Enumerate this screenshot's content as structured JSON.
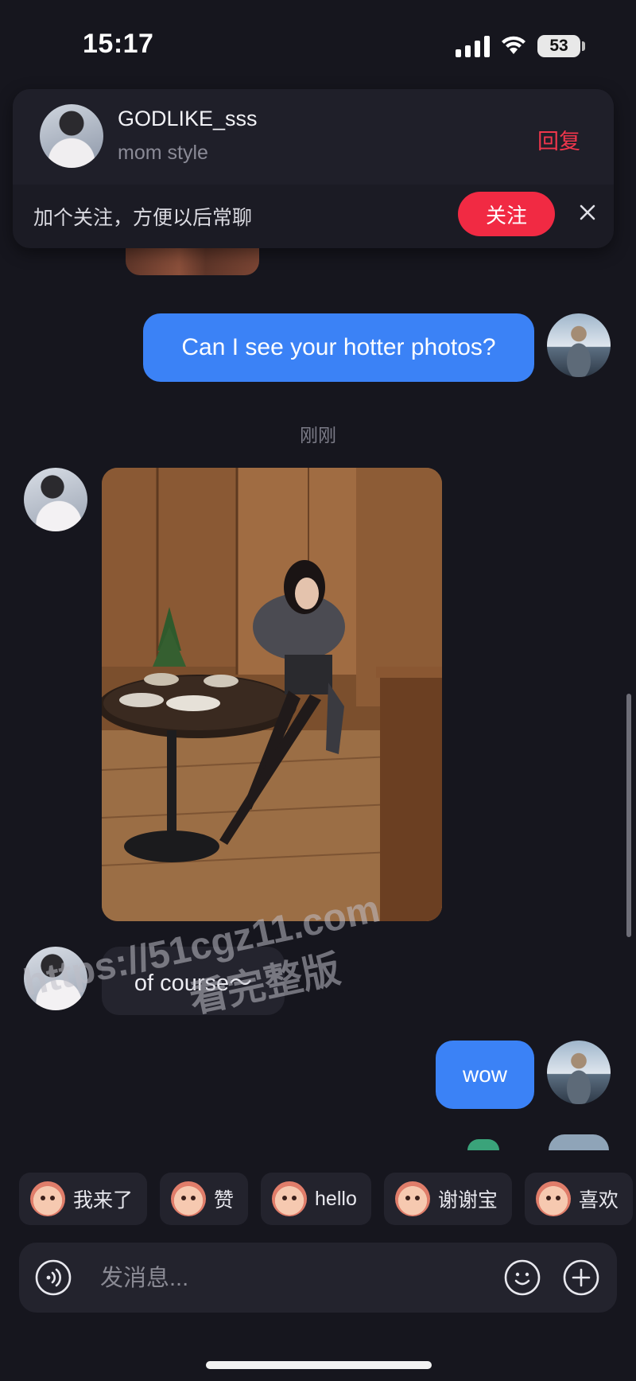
{
  "status_bar": {
    "time": "15:17",
    "battery": "53"
  },
  "notification": {
    "name": "GODLIKE_sss",
    "subtitle": "mom style",
    "reply_label": "回复",
    "hint": "加个关注，方便以后常聊",
    "follow_label": "关注"
  },
  "messages": {
    "msg1": "Can I see your hotter photos?",
    "time_separator": "刚刚",
    "msg2": "of course～",
    "msg3": "wow"
  },
  "watermark": {
    "line1": "https://51cgz11.com",
    "line2": "看完整版"
  },
  "quick_replies": [
    "我来了",
    "赞",
    "hello",
    "谢谢宝",
    "喜欢"
  ],
  "input": {
    "placeholder": "发消息..."
  },
  "colors": {
    "accent_red": "#f12a43",
    "bubble_blue": "#3b82f6",
    "background": "#16161e"
  }
}
